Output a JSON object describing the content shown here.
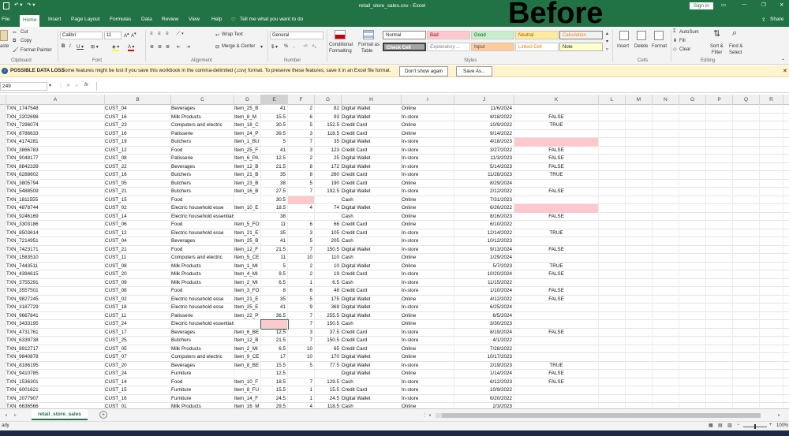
{
  "window": {
    "title": "retail_store_sales.csv  -  Excel",
    "sign_in": "Sign in",
    "share": "Share"
  },
  "ribbon_tabs": [
    "File",
    "Home",
    "Insert",
    "Page Layout",
    "Formulas",
    "Data",
    "Review",
    "View",
    "Help",
    "Tell me what you want to do"
  ],
  "clipboard": {
    "paste": "aste",
    "cut": "Cut",
    "copy": "Copy",
    "format_painter": "Format Painter",
    "label": "Clipboard"
  },
  "font": {
    "name": "Calibri",
    "size": "11",
    "label": "Font"
  },
  "alignment": {
    "wrap": "Wrap Text",
    "merge": "Merge & Center",
    "label": "Alignment"
  },
  "number": {
    "format": "General",
    "label": "Number",
    "pct": "%",
    "comma": ","
  },
  "styles": {
    "cond": "Conditional",
    "cond2": "Formatting",
    "fmt_table": "Format as",
    "fmt_table2": "Table",
    "normal": "Normal",
    "bad": "Bad",
    "good": "Good",
    "neutral": "Neutral",
    "calculation": "Calculation",
    "check": "Check Cell",
    "explanatory": "Explanatory ...",
    "input": "Input",
    "linked": "Linked Cell",
    "note": "Note",
    "label": "Styles"
  },
  "cells": {
    "insert": "Insert",
    "delete": "Delete",
    "format": "Format",
    "label": "Cells"
  },
  "editing": {
    "autosum": "AutoSum",
    "fill": "Fill",
    "clear": "Clear",
    "sort": "Sort &",
    "sort2": "Filter",
    "find": "Find &",
    "find2": "Select",
    "label": "Editing"
  },
  "overlay": "Before",
  "message": {
    "title": "POSSIBLE DATA LOSS",
    "text": "Some features might be lost if you save this workbook in the comma-delimited (.csv) format. To preserve these features, save it in an Excel file format.",
    "dont_show": "Don't show again",
    "save_as": "Save As..."
  },
  "formula": {
    "name_box": "249",
    "fx": "fx",
    "value": ""
  },
  "columns": [
    "A",
    "B",
    "C",
    "D",
    "E",
    "F",
    "G",
    "H",
    "I",
    "J",
    "K",
    "L",
    "M",
    "N",
    "O",
    "P",
    "Q",
    "R"
  ],
  "rows": [
    {
      "a": "TXN_1747548",
      "b": "CUST_04",
      "c": "Beverages",
      "d": "Item_25_B",
      "e": "41",
      "f": "2",
      "g": "82",
      "h": "Digital Wallet",
      "i": "Online",
      "j": "11/6/2024",
      "k": ""
    },
    {
      "a": "TXN_2202698",
      "b": "CUST_16",
      "c": "Milk Products",
      "d": "Item_8_M",
      "e": "15.5",
      "f": "6",
      "g": "93",
      "h": "Digital Wallet",
      "i": "In-store",
      "j": "8/18/2022",
      "k": "FALSE"
    },
    {
      "a": "TXN_7296074",
      "b": "CUST_23",
      "c": "Computers and electric",
      "d": "Item_18_C",
      "e": "30.5",
      "f": "5",
      "g": "152.5",
      "h": "Credit Card",
      "i": "Online",
      "j": "10/9/2022",
      "k": "TRUE"
    },
    {
      "a": "TXN_8786633",
      "b": "CUST_16",
      "c": "Patisserie",
      "d": "Item_24_P",
      "e": "39.5",
      "f": "3",
      "g": "118.5",
      "h": "Credit Card",
      "i": "Online",
      "j": "9/14/2022",
      "k": ""
    },
    {
      "a": "TXN_4174281",
      "b": "CUST_19",
      "c": "Butchers",
      "d": "Item_1_BU",
      "e": "5",
      "f": "7",
      "g": "35",
      "h": "Digital Wallet",
      "i": "In-store",
      "j": "4/18/2023",
      "k": "",
      "kpink": true
    },
    {
      "a": "TXN_3866783",
      "b": "CUST_12",
      "c": "Food",
      "d": "Item_25_F",
      "e": "41",
      "f": "3",
      "g": "123",
      "h": "Credit Card",
      "i": "In-store",
      "j": "3/27/2022",
      "k": "FALSE"
    },
    {
      "a": "TXN_9048177",
      "b": "CUST_08",
      "c": "Patisserie",
      "d": "Item_6_PA",
      "e": "12.5",
      "f": "2",
      "g": "25",
      "h": "Digital Wallet",
      "i": "In-store",
      "j": "11/3/2023",
      "k": "FALSE"
    },
    {
      "a": "TXN_8842339",
      "b": "CUST_22",
      "c": "Beverages",
      "d": "Item_12_B",
      "e": "21.5",
      "f": "8",
      "g": "172",
      "h": "Digital Wallet",
      "i": "In-store",
      "j": "5/14/2023",
      "k": "FALSE"
    },
    {
      "a": "TXN_6288602",
      "b": "CUST_16",
      "c": "Butchers",
      "d": "Item_21_B",
      "e": "35",
      "f": "8",
      "g": "280",
      "h": "Credit Card",
      "i": "In-store",
      "j": "11/28/2023",
      "k": "TRUE"
    },
    {
      "a": "TXN_3805794",
      "b": "CUST_05",
      "c": "Butchers",
      "d": "Item_23_B",
      "e": "38",
      "f": "5",
      "g": "190",
      "h": "Credit Card",
      "i": "Online",
      "j": "8/29/2024",
      "k": ""
    },
    {
      "a": "TXN_5488509",
      "b": "CUST_21",
      "c": "Butchers",
      "d": "Item_16_B",
      "e": "27.5",
      "f": "7",
      "g": "192.5",
      "h": "Digital Wallet",
      "i": "In-store",
      "j": "2/12/2022",
      "k": "FALSE"
    },
    {
      "a": "TXN_1811555",
      "b": "CUST_15",
      "c": "Food",
      "d": "",
      "e": "30.5",
      "f": "",
      "g": "",
      "h": "Cash",
      "i": "Online",
      "j": "7/31/2023",
      "k": "",
      "fpink": true
    },
    {
      "a": "TXN_4878744",
      "b": "CUST_02",
      "c": "Electric household esse",
      "d": "Item_10_E",
      "e": "18.5",
      "f": "4",
      "g": "74",
      "h": "Digital Wallet",
      "i": "Online",
      "j": "6/26/2022",
      "k": "",
      "kpink": true
    },
    {
      "a": "TXN_9246169",
      "b": "CUST_14",
      "c": "Electric household essentials",
      "d": "",
      "e": "38",
      "f": "",
      "g": "",
      "h": "Cash",
      "i": "Online",
      "j": "8/16/2023",
      "k": "FALSE"
    },
    {
      "a": "TXN_3303186",
      "b": "CUST_06",
      "c": "Food",
      "d": "Item_5_FO",
      "e": "11",
      "f": "6",
      "g": "66",
      "h": "Credit Card",
      "i": "Online",
      "j": "6/10/2022",
      "k": ""
    },
    {
      "a": "TXN_8503614",
      "b": "CUST_12",
      "c": "Electric household esse",
      "d": "Item_21_E",
      "e": "35",
      "f": "3",
      "g": "105",
      "h": "Credit Card",
      "i": "In-store",
      "j": "12/14/2022",
      "k": "TRUE"
    },
    {
      "a": "TXN_7214951",
      "b": "CUST_04",
      "c": "Beverages",
      "d": "Item_25_B",
      "e": "41",
      "f": "5",
      "g": "205",
      "h": "Cash",
      "i": "In-store",
      "j": "10/12/2023",
      "k": ""
    },
    {
      "a": "TXN_7423171",
      "b": "CUST_21",
      "c": "Food",
      "d": "Item_12_F",
      "e": "21.5",
      "f": "7",
      "g": "150.5",
      "h": "Digital Wallet",
      "i": "In-store",
      "j": "9/13/2024",
      "k": "FALSE"
    },
    {
      "a": "TXN_1583510",
      "b": "CUST_11",
      "c": "Computers and electric",
      "d": "Item_5_CE",
      "e": "11",
      "f": "10",
      "g": "110",
      "h": "Cash",
      "i": "Online",
      "j": "1/29/2024",
      "k": ""
    },
    {
      "a": "TXN_7443511",
      "b": "CUST_08",
      "c": "Milk Products",
      "d": "Item_1_MI",
      "e": "5",
      "f": "2",
      "g": "10",
      "h": "Digital Wallet",
      "i": "Online",
      "j": "5/7/2023",
      "k": "TRUE"
    },
    {
      "a": "TXN_4394615",
      "b": "CUST_20",
      "c": "Milk Products",
      "d": "Item_4_MI",
      "e": "9.5",
      "f": "2",
      "g": "19",
      "h": "Credit Card",
      "i": "In-store",
      "j": "10/20/2024",
      "k": "FALSE"
    },
    {
      "a": "TXN_3755291",
      "b": "CUST_09",
      "c": "Milk Products",
      "d": "Item_2_MI",
      "e": "6.5",
      "f": "1",
      "g": "6.5",
      "h": "Cash",
      "i": "In-store",
      "j": "11/15/2022",
      "k": ""
    },
    {
      "a": "TXN_3557501",
      "b": "CUST_08",
      "c": "Food",
      "d": "Item_3_FO",
      "e": "8",
      "f": "6",
      "g": "48",
      "h": "Credit Card",
      "i": "In-store",
      "j": "1/10/2024",
      "k": "FALSE"
    },
    {
      "a": "TXN_9827245",
      "b": "CUST_02",
      "c": "Electric household esse",
      "d": "Item_21_E",
      "e": "35",
      "f": "5",
      "g": "175",
      "h": "Digital Wallet",
      "i": "Online",
      "j": "4/12/2022",
      "k": "FALSE"
    },
    {
      "a": "TXN_3187729",
      "b": "CUST_18",
      "c": "Electric household esse",
      "d": "Item_25_E",
      "e": "41",
      "f": "9",
      "g": "369",
      "h": "Digital Wallet",
      "i": "In-store",
      "j": "6/25/2024",
      "k": ""
    },
    {
      "a": "TXN_9667841",
      "b": "CUST_11",
      "c": "Patisserie",
      "d": "Item_22_P",
      "e": "36.5",
      "f": "7",
      "g": "255.5",
      "h": "Digital Wallet",
      "i": "Online",
      "j": "6/5/2024",
      "k": ""
    },
    {
      "a": "TXN_3433195",
      "b": "CUST_24",
      "c": "Electric household essentials",
      "d": "",
      "e": "",
      "f": "7",
      "g": "150.5",
      "h": "Cash",
      "i": "Online",
      "j": "3/30/2023",
      "k": "",
      "epink": true
    },
    {
      "a": "TXN_4731761",
      "b": "CUST_17",
      "c": "Beverages",
      "d": "Item_6_BE",
      "e": "12.5",
      "f": "3",
      "g": "37.5",
      "h": "Credit Card",
      "i": "In-store",
      "j": "8/19/2024",
      "k": "FALSE"
    },
    {
      "a": "TXN_6339738",
      "b": "CUST_25",
      "c": "Butchers",
      "d": "Item_12_B",
      "e": "21.5",
      "f": "7",
      "g": "150.5",
      "h": "Credit Card",
      "i": "In-store",
      "j": "4/1/2022",
      "k": ""
    },
    {
      "a": "TXN_8912717",
      "b": "CUST_05",
      "c": "Milk Products",
      "d": "Item_2_MI",
      "e": "6.5",
      "f": "10",
      "g": "65",
      "h": "Credit Card",
      "i": "Online",
      "j": "7/28/2022",
      "k": ""
    },
    {
      "a": "TXN_9840878",
      "b": "CUST_07",
      "c": "Computers and electric",
      "d": "Item_9_CE",
      "e": "17",
      "f": "10",
      "g": "170",
      "h": "Digital Wallet",
      "i": "Online",
      "j": "10/17/2023",
      "k": ""
    },
    {
      "a": "TXN_8186195",
      "b": "CUST_20",
      "c": "Beverages",
      "d": "Item_8_BE",
      "e": "15.5",
      "f": "5",
      "g": "77.5",
      "h": "Digital Wallet",
      "i": "In-store",
      "j": "2/19/2023",
      "k": "TRUE"
    },
    {
      "a": "TXN_9410785",
      "b": "CUST_24",
      "c": "Furniture",
      "d": "",
      "e": "12.5",
      "f": "",
      "g": "",
      "h": "Digital Wallet",
      "i": "Online",
      "j": "1/14/2024",
      "k": "FALSE"
    },
    {
      "a": "TXN_1536301",
      "b": "CUST_14",
      "c": "Food",
      "d": "Item_10_F",
      "e": "18.5",
      "f": "7",
      "g": "129.5",
      "h": "Cash",
      "i": "In-store",
      "j": "6/12/2023",
      "k": "FALSE"
    },
    {
      "a": "TXN_6001621",
      "b": "CUST_15",
      "c": "Furniture",
      "d": "Item_8_FU",
      "e": "15.5",
      "f": "1",
      "g": "15.5",
      "h": "Credit Card",
      "i": "In-store",
      "j": "10/9/2022",
      "k": ""
    },
    {
      "a": "TXN_2077907",
      "b": "CUST_16",
      "c": "Furniture",
      "d": "Item_14_F",
      "e": "24.5",
      "f": "1",
      "g": "24.5",
      "h": "Digital Wallet",
      "i": "In-store",
      "j": "6/20/2022",
      "k": ""
    },
    {
      "a": "TXN_6636566",
      "b": "CUST_01",
      "c": "Milk Products",
      "d": "Item_16_M",
      "e": "29.5",
      "f": "4",
      "g": "118.5",
      "h": "Cash",
      "i": "Online",
      "j": "2/3/2023",
      "k": ""
    }
  ],
  "sheet": {
    "tab": "retail_store_sales",
    "add": "+"
  },
  "status": {
    "mode": "ady",
    "zoom": "100%"
  },
  "colors": {
    "excel_green": "#217346",
    "bad_fill": "#ffc7ce",
    "message_bar": "#fff4ce"
  }
}
